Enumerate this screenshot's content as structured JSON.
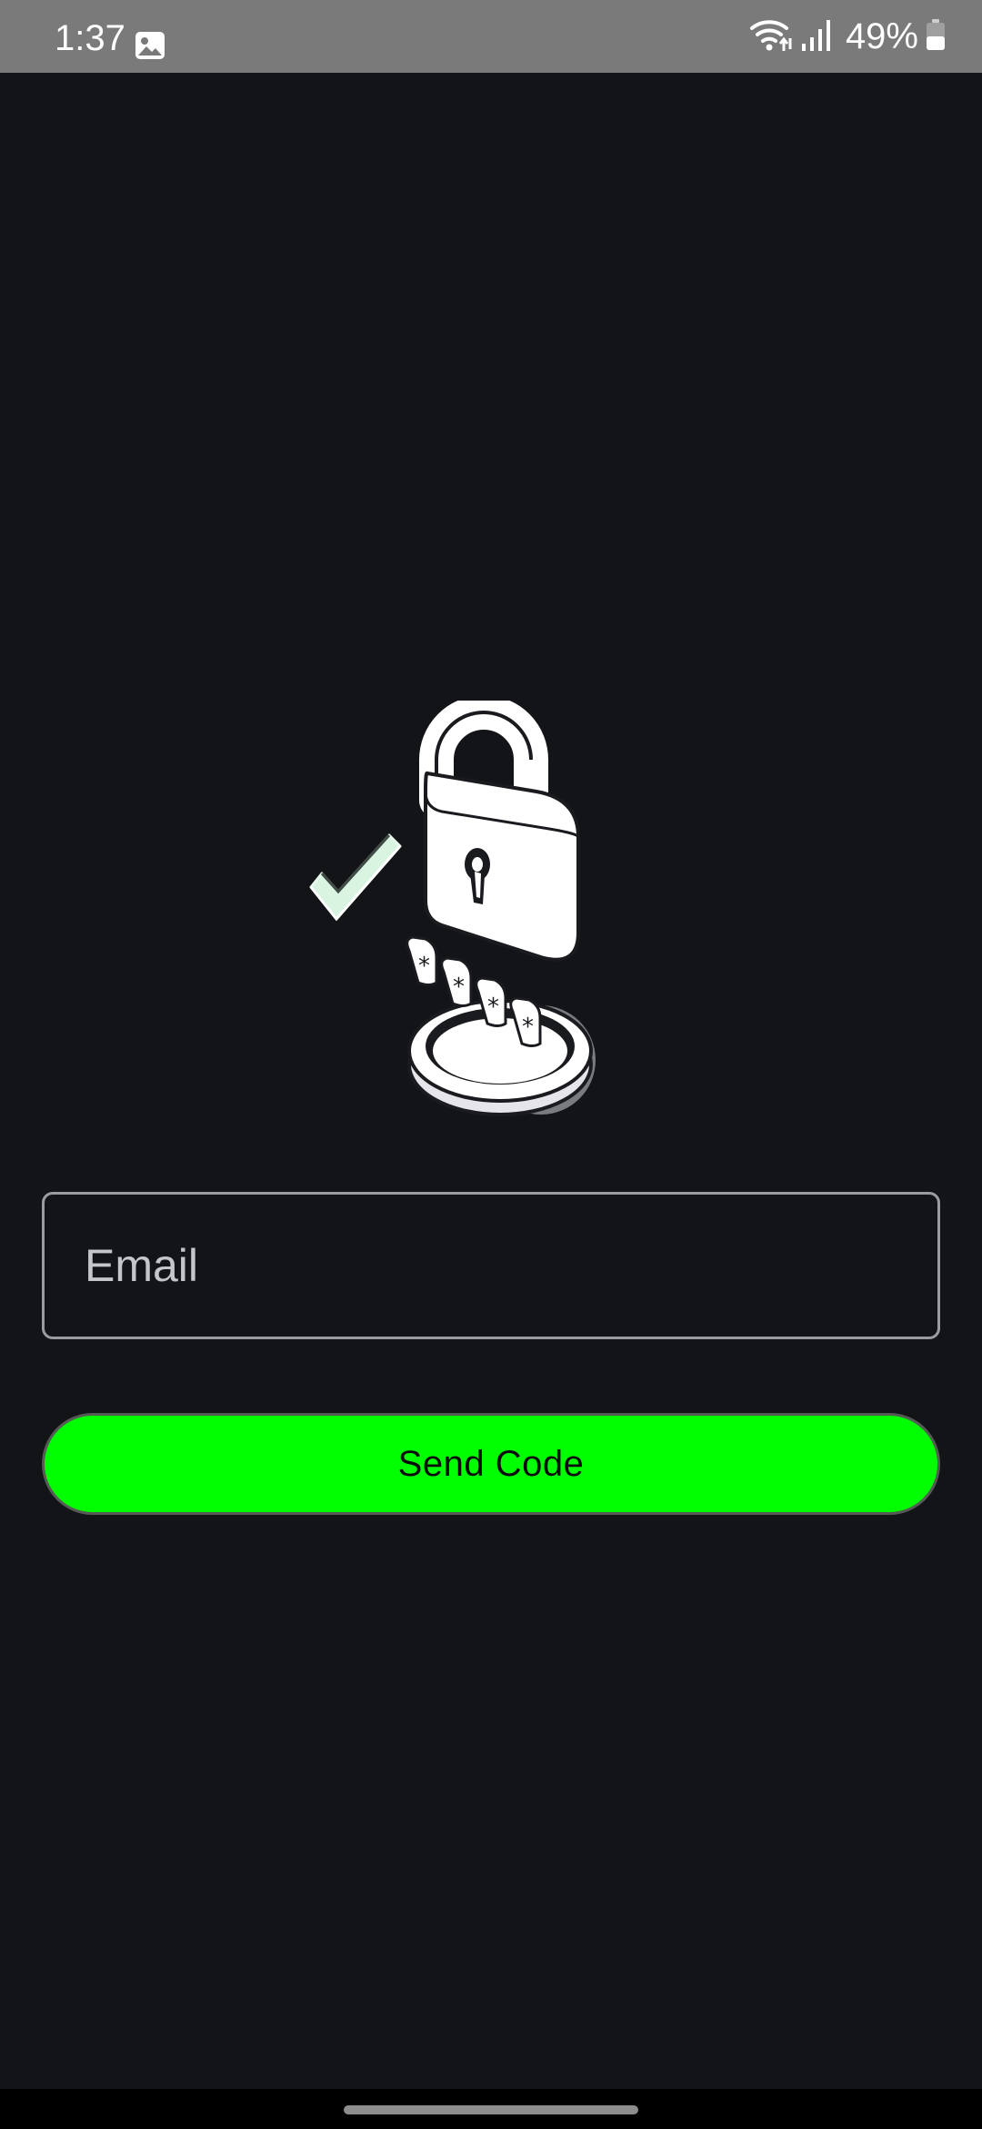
{
  "status_bar": {
    "time": "1:37",
    "battery_percent": "49%",
    "battery_level": 0.49,
    "icons": [
      "gallery-icon",
      "wifi-icon",
      "signal-icon",
      "battery-icon"
    ]
  },
  "illustration": {
    "icon": "padlock-password-icon",
    "pin_glyph": "*"
  },
  "form": {
    "email_placeholder": "Email",
    "email_value": "",
    "send_code_label": "Send Code"
  },
  "colors": {
    "background": "#131418",
    "status_bar": "#7a7a7a",
    "accent": "#00ff00",
    "field_border": "#9a9ca2",
    "check_fill": "#d9f5e2"
  }
}
